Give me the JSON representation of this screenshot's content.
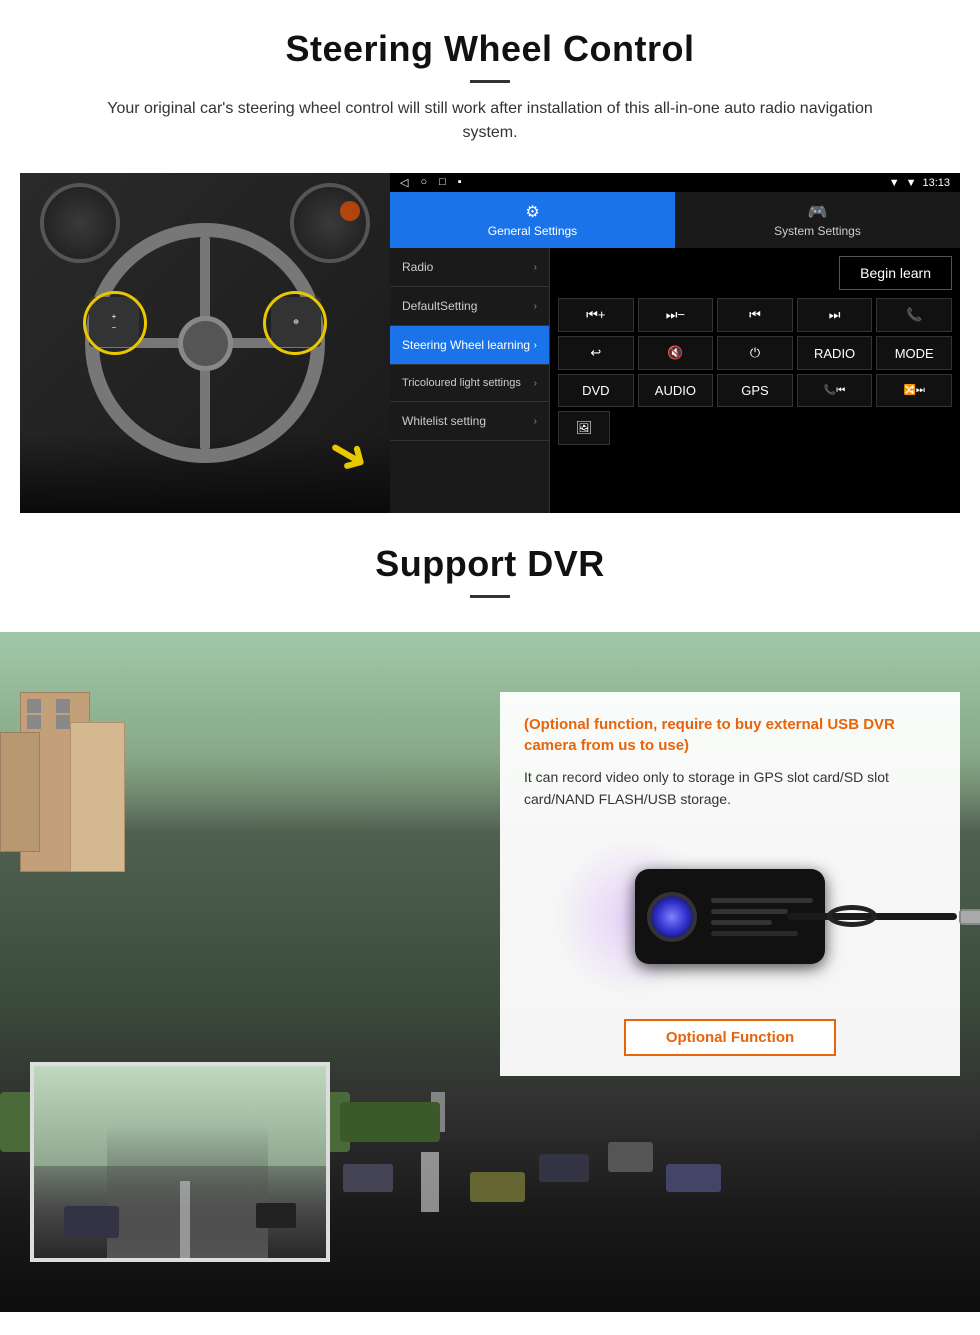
{
  "page": {
    "section1": {
      "title": "Steering Wheel Control",
      "subtitle": "Your original car's steering wheel control will still work after installation of this all-in-one auto radio navigation system.",
      "statusBar": {
        "time": "13:13",
        "navIcons": [
          "◁",
          "○",
          "□",
          "▪"
        ]
      },
      "tabs": [
        {
          "label": "General Settings",
          "icon": "⚙",
          "active": true
        },
        {
          "label": "System Settings",
          "icon": "🎮",
          "active": false
        }
      ],
      "menuItems": [
        {
          "label": "Radio",
          "active": false
        },
        {
          "label": "DefaultSetting",
          "active": false
        },
        {
          "label": "Steering Wheel learning",
          "active": true
        },
        {
          "label": "Tricoloured light settings",
          "active": false
        },
        {
          "label": "Whitelist setting",
          "active": false
        }
      ],
      "beginLearnBtn": "Begin learn",
      "controlButtons": {
        "row1": [
          "⏮+",
          "⏭−",
          "⏮",
          "⏭",
          "📞"
        ],
        "row2": [
          "↩",
          "🔇",
          "⏻",
          "RADIO",
          "MODE"
        ],
        "row3": [
          "DVD",
          "AUDIO",
          "GPS",
          "📞⏮",
          "🔀⏭"
        ]
      }
    },
    "section2": {
      "title": "Support DVR",
      "optionalText": "(Optional function, require to buy external USB DVR camera from us to use)",
      "descText": "It can record video only to storage in GPS slot card/SD slot card/NAND FLASH/USB storage.",
      "optionalBtnLabel": "Optional Function"
    }
  }
}
